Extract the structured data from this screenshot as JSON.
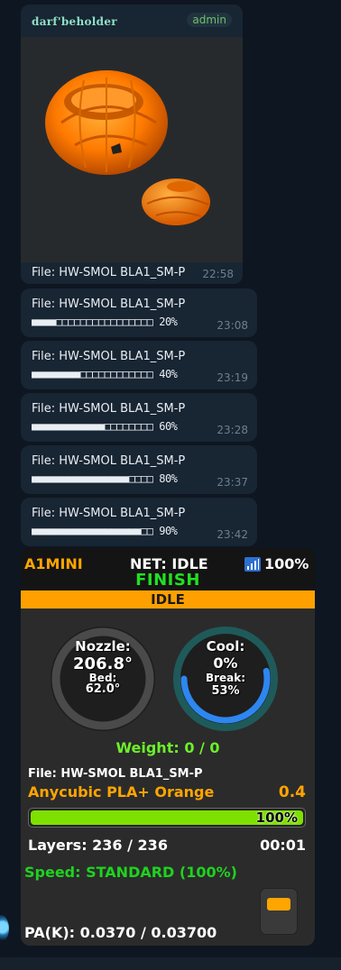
{
  "chat": {
    "photo_message": {
      "sender": "darf'beholder",
      "badge": "admin",
      "caption": "File: HW-SMOL BLA1_SM-P",
      "time": "22:58"
    },
    "messages": [
      {
        "file": "File: HW-SMOL BLA1_SM-P",
        "bar": "■■■■□□□□□□□□□□□□□□□□",
        "percent": "20%",
        "time": "23:08"
      },
      {
        "file": "File: HW-SMOL BLA1_SM-P",
        "bar": "■■■■■■■■□□□□□□□□□□□□",
        "percent": "40%",
        "time": "23:19"
      },
      {
        "file": "File: HW-SMOL BLA1_SM-P",
        "bar": "■■■■■■■■■■■■□□□□□□□□",
        "percent": "60%",
        "time": "23:28"
      },
      {
        "file": "File: HW-SMOL BLA1_SM-P",
        "bar": "■■■■■■■■■■■■■■■■□□□□",
        "percent": "80%",
        "time": "23:37"
      },
      {
        "file": "File: HW-SMOL BLA1_SM-P",
        "bar": "■■■■■■■■■■■■■■■■■■□□",
        "percent": "90%",
        "time": "23:42"
      }
    ]
  },
  "printer": {
    "name": "A1MINI",
    "net": "NET: IDLE",
    "wifi": "100%",
    "wifi_level": 1.0,
    "finish": "FINISH",
    "state": "IDLE",
    "nozzle_label": "Nozzle:",
    "nozzle_temp": "206.8°",
    "bed_label": "Bed:",
    "bed_temp": "62.0°",
    "cool_label": "Cool:",
    "cool_value": "0%",
    "break_label": "Break:",
    "break_value": "53%",
    "break_level": 0.53,
    "weight": "Weight: 0 / 0",
    "file": "File: HW-SMOL BLA1_SM-P",
    "filament": "Anycubic PLA+ Orange",
    "nozzle_size": "0.4",
    "progress_label": "100%",
    "progress_level": 1.0,
    "layers": "Layers: 236 / 236",
    "elapsed": "00:01",
    "speed": "Speed: STANDARD (100%)",
    "pa": "PA(K): 0.0370 / 0.03700"
  },
  "colors": {
    "background": "#0e1621",
    "bubble": "#182533",
    "accent_orange": "#ffa500",
    "green": "#22e022",
    "cool_ring": "#2e86f0"
  }
}
